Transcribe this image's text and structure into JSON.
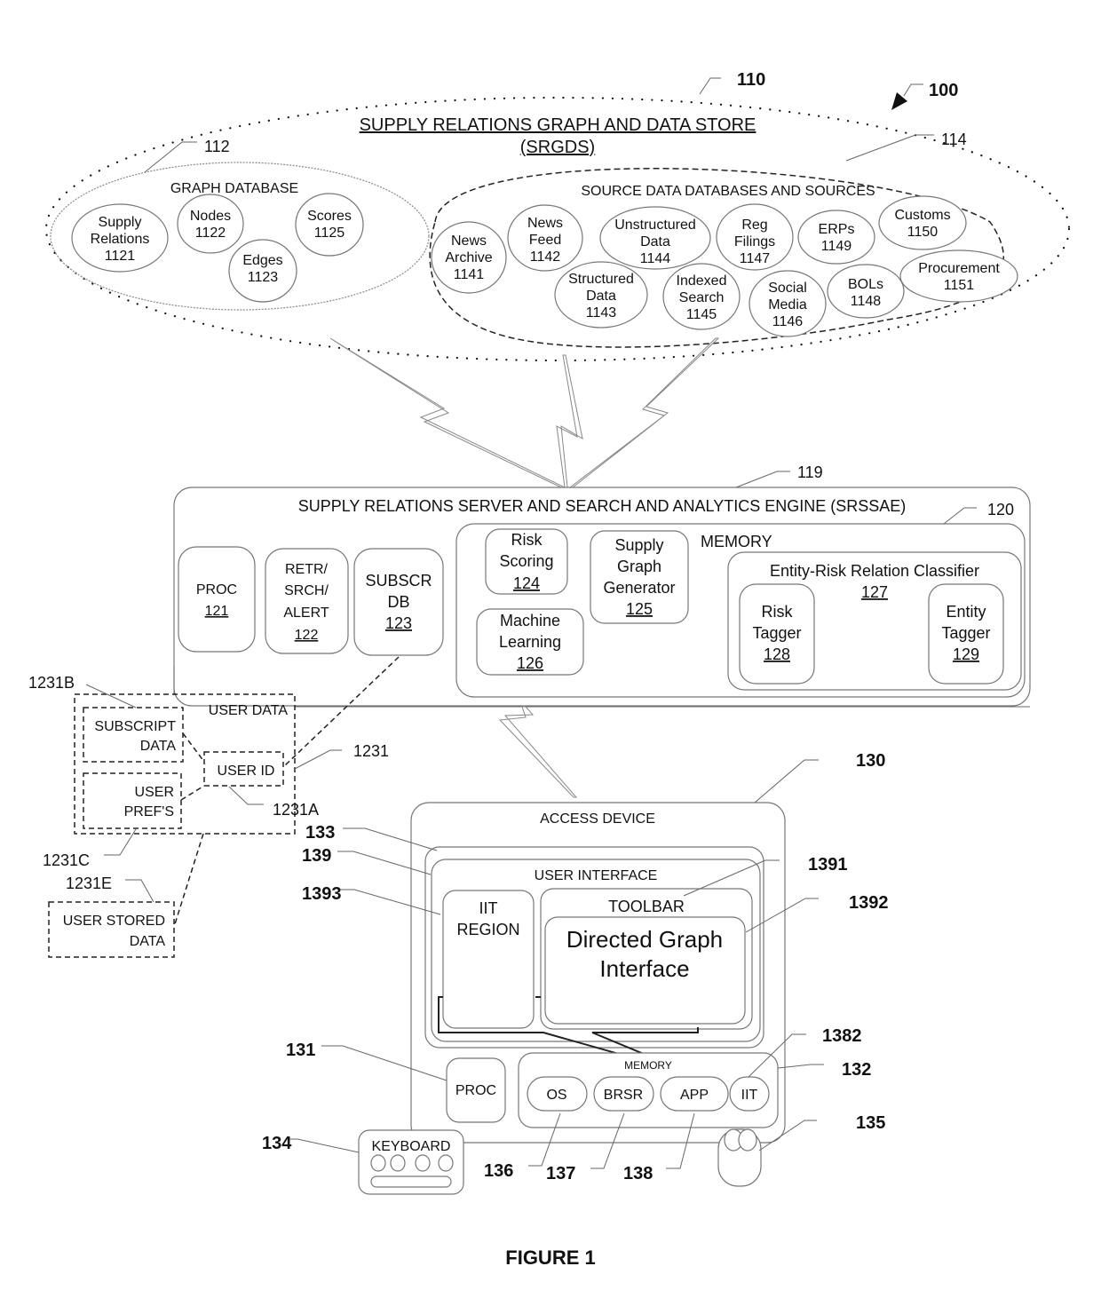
{
  "figure_label": "FIGURE 1",
  "system_ref": "100",
  "srgds": {
    "ref": "110",
    "title_line1": "SUPPLY RELATIONS GRAPH AND DATA STORE",
    "title_line2": "(SRGDS)",
    "graph_database": {
      "ref": "112",
      "title": "GRAPH DATABASE",
      "items": [
        {
          "lines": [
            "Supply",
            "Relations",
            "1121"
          ]
        },
        {
          "lines": [
            "Nodes",
            "1122"
          ]
        },
        {
          "lines": [
            "Edges",
            "1123"
          ]
        },
        {
          "lines": [
            "Scores",
            "1125"
          ]
        }
      ]
    },
    "source_data": {
      "ref": "114",
      "title": "SOURCE DATA DATABASES AND SOURCES",
      "items": [
        {
          "lines": [
            "News",
            "Archive",
            "1141"
          ]
        },
        {
          "lines": [
            "News",
            "Feed",
            "1142"
          ]
        },
        {
          "lines": [
            "Unstructured",
            "Data",
            "1144"
          ]
        },
        {
          "lines": [
            "Reg",
            "Filings",
            "1147"
          ]
        },
        {
          "lines": [
            "ERPs",
            "1149"
          ]
        },
        {
          "lines": [
            "Customs",
            "1150"
          ]
        },
        {
          "lines": [
            "Structured",
            "Data",
            "1143"
          ]
        },
        {
          "lines": [
            "Indexed",
            "Search",
            "1145"
          ]
        },
        {
          "lines": [
            "Social",
            "Media",
            "1146"
          ]
        },
        {
          "lines": [
            "BOLs",
            "1148"
          ]
        },
        {
          "lines": [
            "Procurement",
            "1151"
          ]
        }
      ]
    }
  },
  "srssae": {
    "ref": "119",
    "title": "SUPPLY RELATIONS SERVER AND SEARCH AND ANALYTICS ENGINE (SRSSAE)",
    "proc": {
      "label": "PROC",
      "num": "121"
    },
    "retr": {
      "lines": [
        "RETR/",
        "SRCH/",
        "ALERT"
      ],
      "num": "122"
    },
    "subscr": {
      "lines": [
        "SUBSCR",
        "DB"
      ],
      "num": "123"
    },
    "memory": {
      "ref": "120",
      "label": "MEMORY",
      "risk_scoring": {
        "lines": [
          "Risk",
          "Scoring"
        ],
        "num": "124"
      },
      "supply_graph": {
        "lines": [
          "Supply",
          "Graph",
          "Generator"
        ],
        "num": "125"
      },
      "machine_learning": {
        "lines": [
          "Machine",
          "Learning"
        ],
        "num": "126"
      },
      "classifier": {
        "title": "Entity-Risk Relation Classifier",
        "num": "127",
        "risk_tagger": {
          "lines": [
            "Risk",
            "Tagger"
          ],
          "num": "128"
        },
        "entity_tagger": {
          "lines": [
            "Entity",
            "Tagger"
          ],
          "num": "129"
        }
      }
    }
  },
  "user_data": {
    "ref": "1231",
    "title": "USER DATA",
    "subscript": {
      "ref": "1231B",
      "lines": [
        "SUBSCRIPT",
        "DATA"
      ]
    },
    "prefs": {
      "ref": "1231C",
      "lines": [
        "USER",
        "PREF'S"
      ]
    },
    "user_id": {
      "ref": "1231A",
      "label": "USER ID"
    },
    "stored": {
      "ref": "1231E",
      "lines": [
        "USER STORED",
        "DATA"
      ]
    }
  },
  "access_device": {
    "ref": "130",
    "title": "ACCESS DEVICE",
    "display_ref": "133",
    "ui_ref": "139",
    "ui_title": "USER INTERFACE",
    "iit_region": {
      "ref": "1393",
      "lines": [
        "IIT",
        "REGION"
      ]
    },
    "toolbar": {
      "ref": "1391",
      "label": "TOOLBAR"
    },
    "graph_interface": {
      "ref": "1392",
      "lines": [
        "Directed Graph",
        "Interface"
      ]
    },
    "proc": {
      "ref": "131",
      "label": "PROC"
    },
    "memory": {
      "ref": "132",
      "label": "MEMORY",
      "os": {
        "ref": "136",
        "label": "OS"
      },
      "brsr": {
        "ref": "137",
        "label": "BRSR"
      },
      "app": {
        "ref": "138",
        "label": "APP"
      },
      "iit": {
        "ref": "1382",
        "label": "IIT"
      }
    },
    "keyboard": {
      "ref": "134",
      "label": "KEYBOARD"
    },
    "mouse": {
      "ref": "135"
    }
  }
}
